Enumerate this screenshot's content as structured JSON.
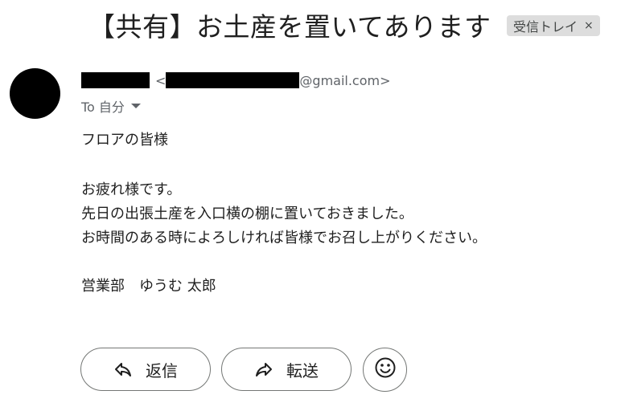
{
  "subject": "【共有】お土産を置いてあります",
  "label": {
    "text": "受信トレイ",
    "close": "×"
  },
  "sender": {
    "email_suffix": "@gmail.com>",
    "email_prefix": "<"
  },
  "recipient": {
    "to_label": "To 自分"
  },
  "body": {
    "greeting": "フロアの皆様",
    "lines": [
      "お疲れ様です。",
      "先日の出張土産を入口横の棚に置いておきました。",
      "お時間のある時によろしければ皆様でお召し上がりください。"
    ],
    "signature": "営業部　ゆうむ 太郎"
  },
  "actions": {
    "reply_label": "返信",
    "forward_label": "転送"
  },
  "icons": {
    "reply": "reply-arrow-icon",
    "forward": "forward-arrow-icon",
    "emoji": "smiley-face-icon",
    "caret": "caret-down-icon"
  },
  "colors": {
    "avatar": "#000000",
    "chip_bg": "#dddddd",
    "secondary_text": "#5f6368"
  }
}
